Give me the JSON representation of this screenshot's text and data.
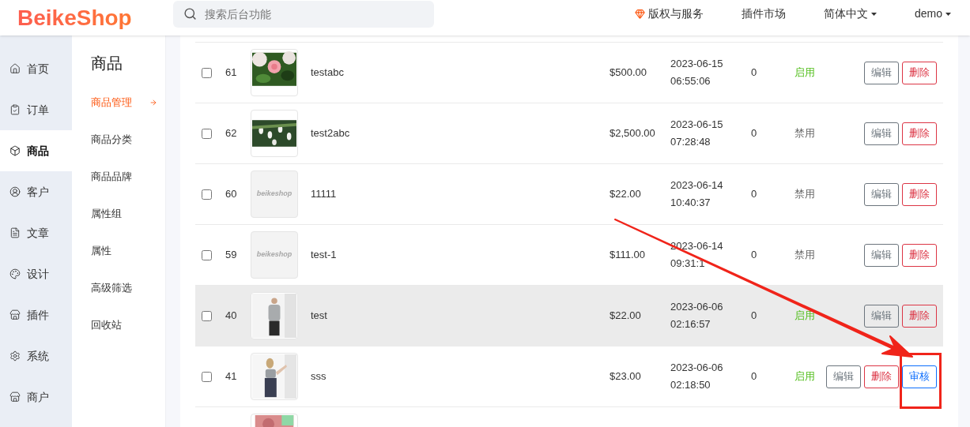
{
  "header": {
    "logo": "BeikeShop",
    "search": {
      "placeholder": "搜索后台功能"
    },
    "links": [
      {
        "label": "版权与服务",
        "dropdown": false
      },
      {
        "label": "插件市场",
        "dropdown": false
      },
      {
        "label": "简体中文",
        "dropdown": true
      },
      {
        "label": "demo",
        "dropdown": true
      }
    ]
  },
  "sidebar": {
    "items": [
      {
        "label": "首页",
        "selected": false
      },
      {
        "label": "订单",
        "selected": false
      },
      {
        "label": "商品",
        "selected": true
      },
      {
        "label": "客户",
        "selected": false
      },
      {
        "label": "文章",
        "selected": false
      },
      {
        "label": "设计",
        "selected": false
      },
      {
        "label": "插件",
        "selected": false
      },
      {
        "label": "系统",
        "selected": false
      },
      {
        "label": "商户",
        "selected": false
      }
    ]
  },
  "submenu": {
    "title": "商品",
    "items": [
      {
        "label": "商品管理",
        "selected": true
      },
      {
        "label": "商品分类",
        "selected": false
      },
      {
        "label": "商品品牌",
        "selected": false
      },
      {
        "label": "属性组",
        "selected": false
      },
      {
        "label": "属性",
        "selected": false
      },
      {
        "label": "高级筛选",
        "selected": false
      },
      {
        "label": "回收站",
        "selected": false
      }
    ]
  },
  "table": {
    "rows": [
      {
        "checked": false,
        "id": "61",
        "image": {
          "kind": "picture"
        },
        "name": "testabc",
        "price": "$500.00",
        "date": "2023-06-15",
        "time": "06:55:06",
        "sales": "0",
        "status": "启用",
        "enabled": true,
        "highlighted": false,
        "actions": [
          {
            "label": "编辑",
            "kind": "edit"
          },
          {
            "label": "删除",
            "kind": "delete"
          }
        ]
      },
      {
        "checked": false,
        "id": "62",
        "image": {
          "kind": "picture"
        },
        "name": "test2abc",
        "price": "$2,500.00",
        "date": "2023-06-15",
        "time": "07:28:48",
        "sales": "0",
        "status": "禁用",
        "enabled": false,
        "highlighted": false,
        "actions": [
          {
            "label": "编辑",
            "kind": "edit"
          },
          {
            "label": "删除",
            "kind": "delete"
          }
        ]
      },
      {
        "checked": false,
        "id": "60",
        "image": {
          "kind": "placeholder",
          "text": "beikeshop"
        },
        "name": "11111",
        "price": "$22.00",
        "date": "2023-06-14",
        "time": "10:40:37",
        "sales": "0",
        "status": "禁用",
        "enabled": false,
        "highlighted": false,
        "actions": [
          {
            "label": "编辑",
            "kind": "edit"
          },
          {
            "label": "删除",
            "kind": "delete"
          }
        ]
      },
      {
        "checked": false,
        "id": "59",
        "image": {
          "kind": "placeholder",
          "text": "beikeshop"
        },
        "name": "test-1",
        "price": "$111.00",
        "date": "2023-06-14",
        "time": "09:31:1",
        "sales": "0",
        "status": "禁用",
        "enabled": false,
        "highlighted": false,
        "actions": [
          {
            "label": "编辑",
            "kind": "edit"
          },
          {
            "label": "删除",
            "kind": "delete"
          }
        ]
      },
      {
        "checked": false,
        "id": "40",
        "image": {
          "kind": "picture"
        },
        "name": "test",
        "price": "$22.00",
        "date": "2023-06-06",
        "time": "02:16:57",
        "sales": "0",
        "status": "启用",
        "enabled": true,
        "highlighted": true,
        "actions": [
          {
            "label": "编辑",
            "kind": "edit"
          },
          {
            "label": "删除",
            "kind": "delete"
          }
        ]
      },
      {
        "checked": false,
        "id": "41",
        "image": {
          "kind": "picture"
        },
        "name": "sss",
        "price": "$23.00",
        "date": "2023-06-06",
        "time": "02:18:50",
        "sales": "0",
        "status": "启用",
        "enabled": true,
        "highlighted": false,
        "actions": [
          {
            "label": "编辑",
            "kind": "edit"
          },
          {
            "label": "删除",
            "kind": "delete"
          },
          {
            "label": "审核",
            "kind": "review"
          }
        ]
      },
      {
        "image": {
          "kind": "picture"
        }
      }
    ]
  }
}
